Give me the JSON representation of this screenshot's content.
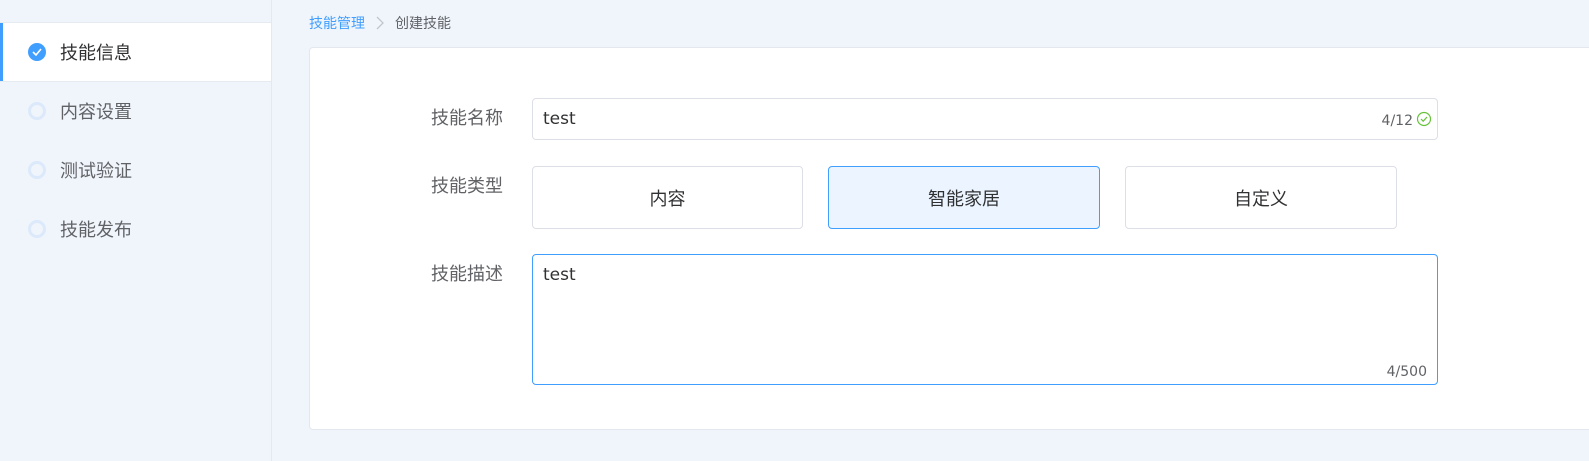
{
  "sidebar": {
    "steps": [
      {
        "label": "技能信息",
        "state": "done"
      },
      {
        "label": "内容设置",
        "state": "pending"
      },
      {
        "label": "测试验证",
        "state": "pending"
      },
      {
        "label": "技能发布",
        "state": "pending"
      }
    ]
  },
  "breadcrumb": {
    "parent": "技能管理",
    "current": "创建技能"
  },
  "form": {
    "name": {
      "label": "技能名称",
      "value": "test",
      "counter": "4/12"
    },
    "type": {
      "label": "技能类型",
      "options": [
        "内容",
        "智能家居",
        "自定义"
      ],
      "selected": "智能家居"
    },
    "description": {
      "label": "技能描述",
      "value": "test",
      "counter": "4/500"
    }
  },
  "colors": {
    "accent": "#409eff",
    "success": "#67c23a",
    "selected_bg": "#ecf5ff",
    "page_bg": "#f0f5fc"
  },
  "icons": {
    "step_done": "check-circle-icon",
    "step_pending": "ring-icon",
    "breadcrumb_separator": "chevron-right-icon",
    "input_valid": "check-circle-outline-icon"
  }
}
